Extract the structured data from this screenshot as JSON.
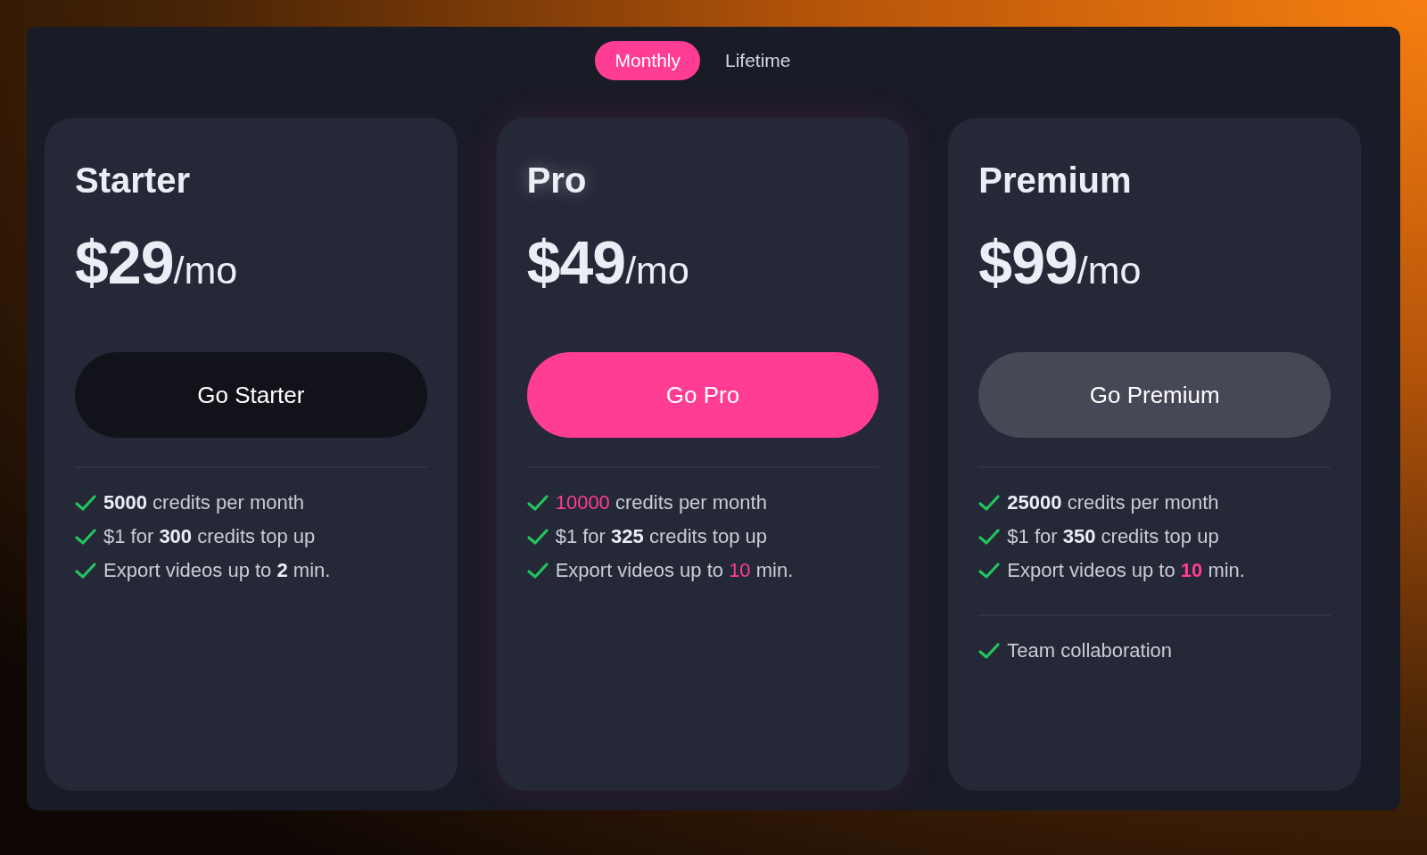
{
  "billing_tabs": [
    {
      "label": "Monthly",
      "selected": true
    },
    {
      "label": "Lifetime",
      "selected": false
    }
  ],
  "plans": [
    {
      "name": "Starter",
      "price": "$29",
      "period": "/mo",
      "featured": false,
      "button": {
        "label": "Go Starter",
        "kind": "dark"
      },
      "features": [
        "**5000** credits per month",
        "$1 for **300** credits top up",
        "Export videos up to **2** min."
      ]
    },
    {
      "name": "Pro",
      "price": "$49",
      "period": "/mo",
      "featured": true,
      "emphasis_bold": false,
      "button": {
        "label": "Go Pro",
        "kind": "accent"
      },
      "features": [
        "*10000* credits per month",
        "$1 for **325** credits top up",
        "Export videos up to *10* min."
      ]
    },
    {
      "name": "Premium",
      "price": "$99",
      "period": "/mo",
      "featured": false,
      "emphasis_bold": true,
      "button": {
        "label": "Go Premium",
        "kind": "muted"
      },
      "features": [
        "**25000** credits per month",
        "$1 for **350** credits top up",
        "Export videos up to *10* min."
      ],
      "extra_features": [
        "Team collaboration"
      ]
    }
  ]
}
